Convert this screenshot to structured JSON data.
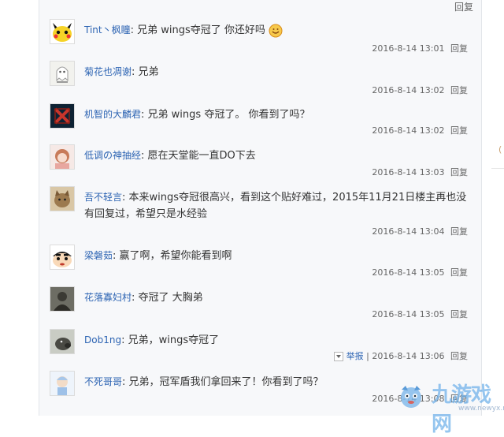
{
  "top_link": "回复",
  "reply_label": "回复",
  "report_label": "举报",
  "colors": {
    "username": "#2d64b3",
    "text": "#333333",
    "meta": "#666666"
  },
  "replies": [
    {
      "avatar": "pikachu-avatar",
      "user": "Tint丶枫瞳",
      "sep": ":",
      "text": "兄弟 wings夺冠了 你还好吗",
      "time": "2016-8-14 13:01",
      "emoji": "smile-emoji-icon"
    },
    {
      "avatar": "ghost-avatar",
      "user": "菊花也凋谢",
      "sep": ":",
      "text": "兄弟",
      "time": "2016-8-14 13:02"
    },
    {
      "avatar": "dota-avatar",
      "user": "机智的大麟君",
      "sep": ":",
      "text": "兄弟 wings 夺冠了。 你看到了吗？",
      "time": "2016-8-14 13:02"
    },
    {
      "avatar": "girl-avatar",
      "user": "低调の神抽经",
      "sep": ":",
      "text": "愿在天堂能一直DO下去",
      "time": "2016-8-14 13:03"
    },
    {
      "avatar": "cat-avatar",
      "user": "吾不轻言",
      "sep": ":",
      "text": "本来wings夺冠很高兴，看到这个贴好难过，2015年11月21日楼主再也没有回复过，希望只是水经验",
      "time": "2016-8-14 13:04"
    },
    {
      "avatar": "shinchan-avatar",
      "user": "梁磐茹",
      "sep": ":",
      "text": "赢了啊，希望你能看到啊",
      "time": "2016-8-14 13:05"
    },
    {
      "avatar": "man-avatar",
      "user": "花落寡妇村",
      "sep": ":",
      "text": "夺冠了 大胸弟",
      "time": "2016-8-14 13:05"
    },
    {
      "avatar": "dog-avatar",
      "user": "Dob1ng",
      "sep": ":",
      "text": "兄弟，wings夺冠了",
      "time": "2016-8-14 13:06",
      "report": true
    },
    {
      "avatar": "anime-avatar",
      "user": "不死哥哥",
      "sep": ":",
      "text": "兄弟，冠军盾我们拿回来了！你看到了吗？",
      "time": "2016-8-14 13:08"
    }
  ],
  "watermark": {
    "text": "九游戏网",
    "url": "www.newyx.net"
  }
}
